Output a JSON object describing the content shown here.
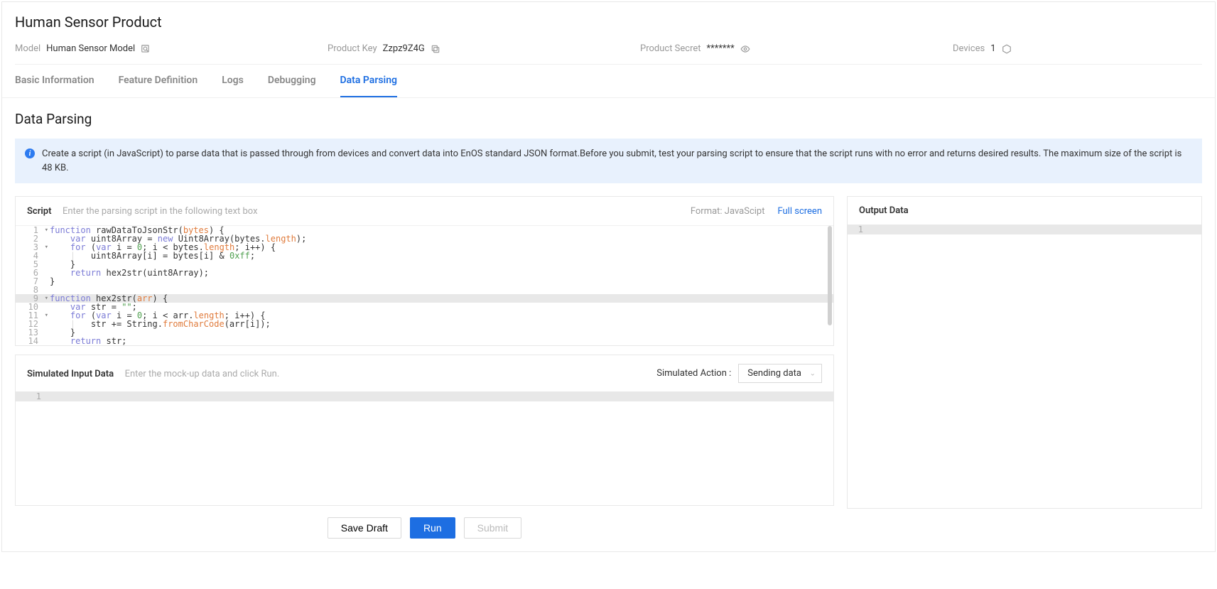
{
  "header": {
    "title": "Human Sensor Product",
    "model_label": "Model",
    "model_value": "Human Sensor Model",
    "product_key_label": "Product Key",
    "product_key_value": "Zzpz9Z4G",
    "product_secret_label": "Product Secret",
    "product_secret_value": "*******",
    "devices_label": "Devices",
    "devices_value": "1"
  },
  "tabs": {
    "basic": "Basic Information",
    "feature": "Feature Definition",
    "logs": "Logs",
    "debugging": "Debugging",
    "data_parsing": "Data Parsing"
  },
  "section": {
    "title": "Data Parsing",
    "info": "Create a script (in JavaScript) to parse data that is passed through from devices and convert data into EnOS standard JSON format.Before you submit, test your parsing script to ensure that the script runs with no error and returns desired results. The maximum size of the script is 48 KB."
  },
  "script_panel": {
    "title": "Script",
    "subtitle": "Enter the parsing script in the following text box",
    "format_label": "Format: JavaScipt",
    "fullscreen": "Full screen"
  },
  "code": {
    "lines": [
      "1",
      "2",
      "3",
      "4",
      "5",
      "6",
      "7",
      "8",
      "9",
      "10",
      "11",
      "12",
      "13",
      "14"
    ],
    "fold_lines": [
      "1",
      "3",
      "9",
      "11"
    ]
  },
  "input_panel": {
    "title": "Simulated Input Data",
    "subtitle": "Enter the mock-up data and click Run.",
    "action_label": "Simulated Action :",
    "action_value": "Sending data",
    "line1": "1"
  },
  "output_panel": {
    "title": "Output Data",
    "line1": "1"
  },
  "buttons": {
    "save_draft": "Save Draft",
    "run": "Run",
    "submit": "Submit"
  }
}
